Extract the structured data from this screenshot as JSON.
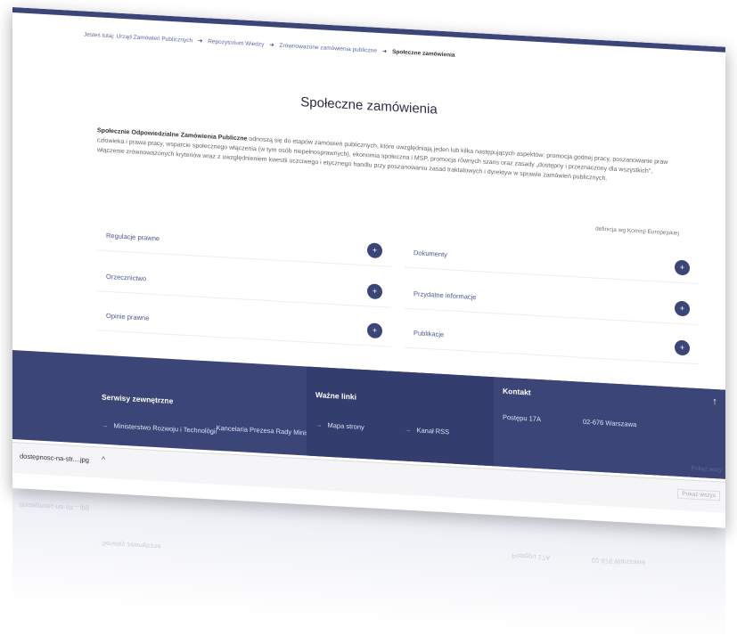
{
  "breadcrumb": {
    "prefix": "Jesteś tutaj:",
    "items": [
      "Urząd Zamówień Publicznych",
      "Repozytorium Wiedzy",
      "Zrównoważone zamówienia publiczne"
    ],
    "current": "Społeczne zamówienia"
  },
  "page": {
    "title": "Społeczne zamówienia",
    "intro_bold": "Społecznie Odpowiedzialne Zamówienia Publiczne",
    "intro_text": " odnoszą się do etapów zamówień publicznych, które uwzględniają jeden lub kilka następujących aspektów: promocja godnej pracy, poszanowanie praw człowieka i prawa pracy, wsparcie społecznego włączenia (w tym osób niepełnosprawnych), ekonomia społeczna i MSP, promocja równych szans oraz zasady „dostępny i przeznaczony dla wszystkich\", włączenie zrównoważonych kryteriów wraz z uwzględnieniem kwestii uczciwego i etycznego handlu przy poszanowaniu zasad traktatowych i dyrektyw w sprawie zamówień publicznych.",
    "source": "definicja wg Komisji Europejskiej"
  },
  "tiles": [
    {
      "label": "Regulacje prawne"
    },
    {
      "label": "Dokumenty"
    },
    {
      "label": "Orzecznictwo"
    },
    {
      "label": "Przydatne informacje"
    },
    {
      "label": "Opinie prawne"
    },
    {
      "label": "Publikacje"
    }
  ],
  "footer": {
    "col1_title": "Serwisy zewnętrzne",
    "col1_link1": "Ministerstwo Rozwoju i Technologii",
    "col1_link2": "Kancelaria Prezesa Rady Ministrów",
    "col2_title": "Ważne linki",
    "col2_link1": "Mapa strony",
    "col2_link2": "Kanał RSS",
    "col3_title": "Kontakt",
    "col3_street": "Postępu 17A",
    "col3_city": "02-676 Warszawa",
    "scroll_top": "↑",
    "more_link": "Pokaż wszy"
  },
  "download": {
    "file": "dostepnosc-na-str....jpg",
    "chevron": "^",
    "show_all": "Pokaż wszys"
  },
  "colors": {
    "accent": "#3b4577"
  }
}
